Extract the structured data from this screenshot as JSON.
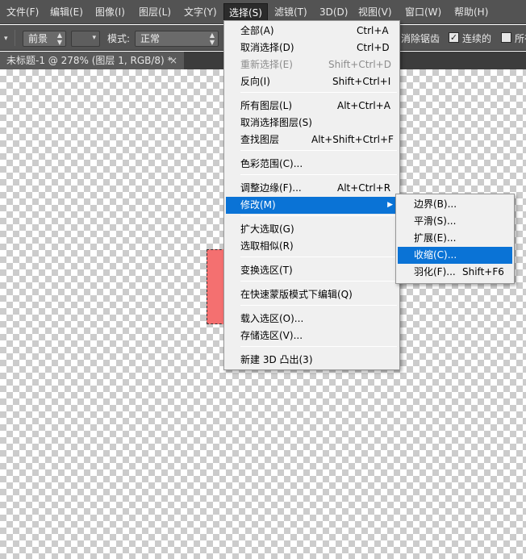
{
  "menubar": {
    "items": [
      "文件(F)",
      "编辑(E)",
      "图像(I)",
      "图层(L)",
      "文字(Y)",
      "选择(S)",
      "滤镜(T)",
      "3D(D)",
      "视图(V)",
      "窗口(W)",
      "帮助(H)"
    ],
    "active": "选择(S)"
  },
  "options": {
    "mode_preset": "前景",
    "mode_label": "模式:",
    "mode_value": "正常",
    "antialias_label": "消除锯齿",
    "contiguous_label": "连续的",
    "all_layers_label": "所有",
    "antialias_checked": true,
    "contiguous_checked": true,
    "all_layers_checked": false
  },
  "document": {
    "tab_title": "未标题-1 @ 278% (图层 1, RGB/8) *",
    "close_glyph": "×"
  },
  "select_menu": {
    "items": [
      {
        "label": "全部(A)",
        "shortcut": "Ctrl+A",
        "disabled": false
      },
      {
        "label": "取消选择(D)",
        "shortcut": "Ctrl+D",
        "disabled": false
      },
      {
        "label": "重新选择(E)",
        "shortcut": "Shift+Ctrl+D",
        "disabled": true
      },
      {
        "label": "反向(I)",
        "shortcut": "Shift+Ctrl+I",
        "disabled": false
      },
      {
        "label": "所有图层(L)",
        "shortcut": "Alt+Ctrl+A",
        "disabled": false
      },
      {
        "label": "取消选择图层(S)",
        "shortcut": "",
        "disabled": false
      },
      {
        "label": "查找图层",
        "shortcut": "Alt+Shift+Ctrl+F",
        "disabled": false
      },
      {
        "label": "色彩范围(C)...",
        "shortcut": "",
        "disabled": false
      },
      {
        "label": "调整边缘(F)...",
        "shortcut": "Alt+Ctrl+R",
        "disabled": false
      },
      {
        "label": "修改(M)",
        "shortcut": "",
        "disabled": false,
        "submenu": true,
        "highlighted": true
      },
      {
        "label": "扩大选取(G)",
        "shortcut": "",
        "disabled": false
      },
      {
        "label": "选取相似(R)",
        "shortcut": "",
        "disabled": false
      },
      {
        "label": "变换选区(T)",
        "shortcut": "",
        "disabled": false
      },
      {
        "label": "在快速蒙版模式下编辑(Q)",
        "shortcut": "",
        "disabled": false
      },
      {
        "label": "载入选区(O)...",
        "shortcut": "",
        "disabled": false
      },
      {
        "label": "存储选区(V)...",
        "shortcut": "",
        "disabled": false
      },
      {
        "label": "新建 3D 凸出(3)",
        "shortcut": "",
        "disabled": false
      }
    ]
  },
  "modify_submenu": {
    "items": [
      {
        "label": "边界(B)...",
        "shortcut": ""
      },
      {
        "label": "平滑(S)...",
        "shortcut": ""
      },
      {
        "label": "扩展(E)...",
        "shortcut": ""
      },
      {
        "label": "收缩(C)...",
        "shortcut": "",
        "highlighted": true
      },
      {
        "label": "羽化(F)...",
        "shortcut": "Shift+F6"
      }
    ]
  },
  "icons": {
    "submenu_arrow": "▶",
    "select_arrows": "▲▼",
    "check": "✓",
    "dropdown_caret": "▾"
  },
  "colors": {
    "menubar_bg": "#535353",
    "menu_highlight": "#0a73d6",
    "selection_fill": "#f47070"
  }
}
